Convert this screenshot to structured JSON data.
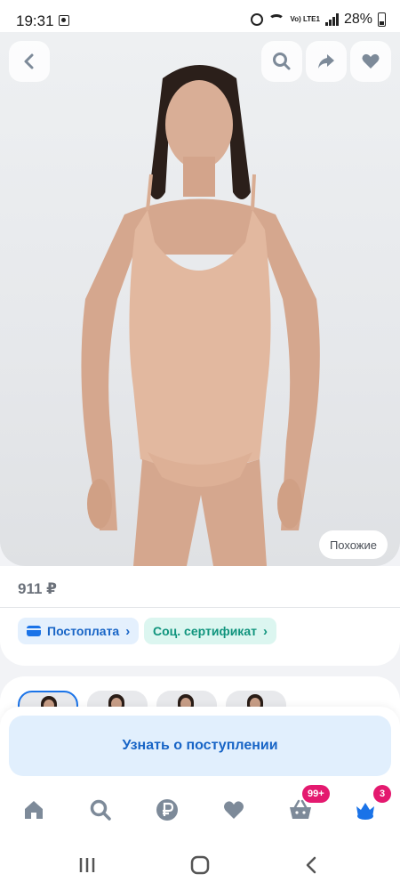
{
  "status_bar": {
    "time": "19:31",
    "network": "Vo) LTE1",
    "battery": "28%"
  },
  "product": {
    "similar_label": "Похожие",
    "price": "911 ₽"
  },
  "chips": {
    "postpay": "Постоплата",
    "social_certificate": "Соц. сертификат"
  },
  "notify": {
    "label": "Узнать о поступлении"
  },
  "tabbar": {
    "items": [
      "home-icon",
      "search-icon",
      "ruble-icon",
      "heart-icon",
      "basket-icon",
      "profile-crown-icon"
    ],
    "basket_badge": "99+",
    "profile_badge": "3"
  },
  "colors": {
    "accent_blue": "#1a73e8",
    "badge_pink": "#e4196f",
    "chip_teal": "#10947d",
    "icon_gray": "#7d8a99"
  }
}
